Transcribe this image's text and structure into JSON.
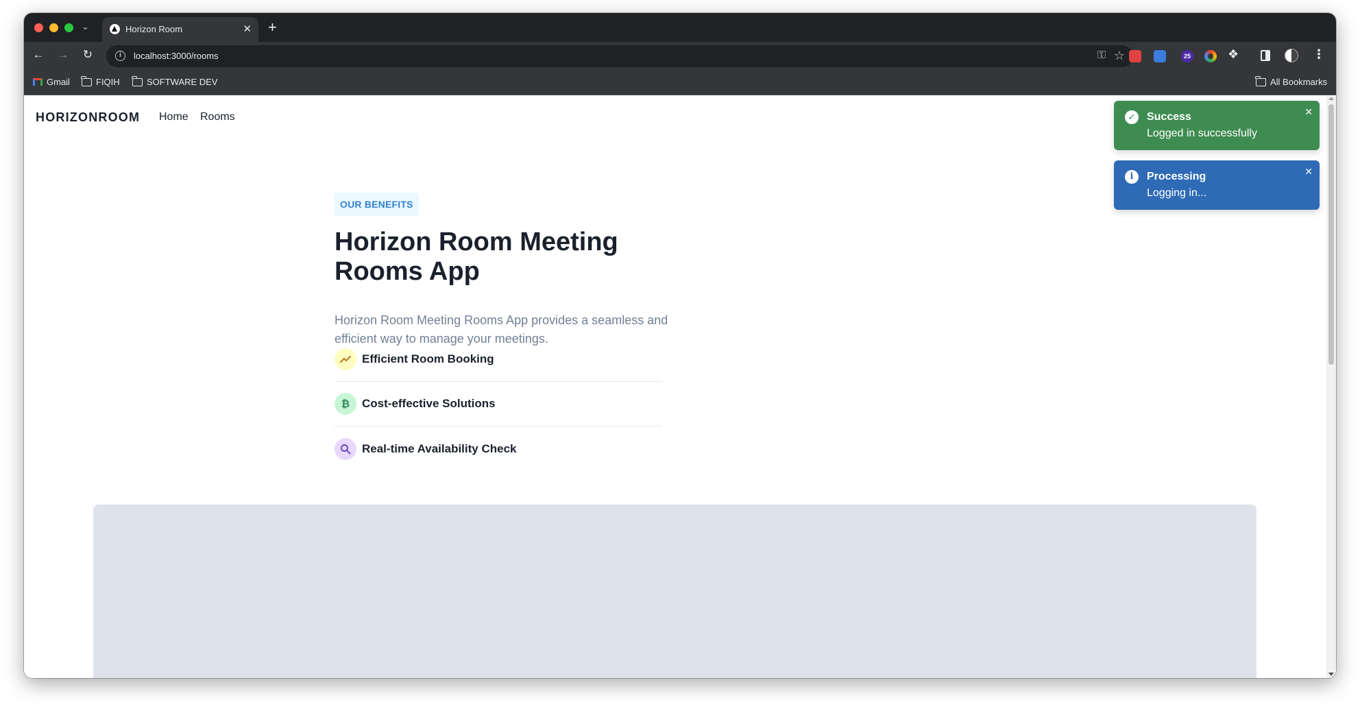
{
  "browser": {
    "tab_title": "Horizon Room",
    "url": "localhost:3000/rooms",
    "extension_badge": "25",
    "bookmarks": [
      {
        "label": "Gmail",
        "icon": "gmail-icon"
      },
      {
        "label": "FIQIH",
        "icon": "folder-icon"
      },
      {
        "label": "SOFTWARE DEV",
        "icon": "folder-icon"
      }
    ],
    "all_bookmarks_label": "All Bookmarks"
  },
  "nav": {
    "logo": "HORIZONROOM",
    "links": [
      "Home",
      "Rooms"
    ]
  },
  "hero": {
    "badge": "OUR BENEFITS",
    "title": "Horizon Room Meeting Rooms App",
    "description": "Horizon Room Meeting Rooms App provides a seamless and efficient way to manage your meetings.",
    "features": [
      {
        "label": "Efficient Room Booking",
        "icon": "trending-up-icon",
        "color": "#fefcbf"
      },
      {
        "label": "Cost-effective Solutions",
        "icon": "bitcoin-icon",
        "color": "#c6f6d5"
      },
      {
        "label": "Real-time Availability Check",
        "icon": "search-icon",
        "color": "#e9d8fd"
      }
    ]
  },
  "toasts": [
    {
      "title": "Success",
      "description": "Logged in successfully",
      "status": "success",
      "color": "#3f8c52"
    },
    {
      "title": "Processing",
      "description": "Logging in...",
      "status": "info",
      "color": "#2e6ab5"
    }
  ]
}
